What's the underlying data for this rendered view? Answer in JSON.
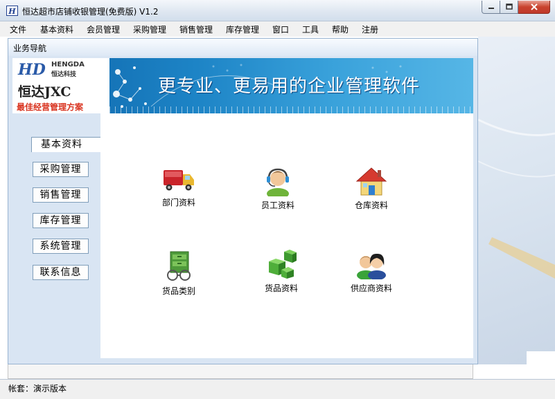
{
  "window": {
    "title": "恒达超市店铺收银管理(免费版) V1.2",
    "icon_letter": "H"
  },
  "menu": [
    {
      "label": "文件"
    },
    {
      "label": "基本资料"
    },
    {
      "label": "会员管理"
    },
    {
      "label": "采购管理"
    },
    {
      "label": "销售管理"
    },
    {
      "label": "库存管理"
    },
    {
      "label": "窗口"
    },
    {
      "label": "工具"
    },
    {
      "label": "帮助"
    },
    {
      "label": "注册"
    }
  ],
  "nav_panel": {
    "title": "业务导航"
  },
  "banner": {
    "logo_letters": "HD",
    "logo_en": "HENGDA",
    "logo_cn": "恒达科技",
    "brand": "恒达JXC",
    "slogan": "最佳经营管理方案",
    "tagline": "更专业、更易用的企业管理软件"
  },
  "sidebar": {
    "active": "基本资料",
    "items": [
      {
        "label": "基本资料"
      },
      {
        "label": "采购管理"
      },
      {
        "label": "销售管理"
      },
      {
        "label": "库存管理"
      },
      {
        "label": "系统管理"
      },
      {
        "label": "联系信息"
      }
    ]
  },
  "tiles": [
    {
      "label": "部门资料",
      "icon": "truck-icon"
    },
    {
      "label": "员工资料",
      "icon": "headset-user-icon"
    },
    {
      "label": "仓库资料",
      "icon": "house-icon"
    },
    {
      "label": "货品类别",
      "icon": "cabinet-icon"
    },
    {
      "label": "货品资料",
      "icon": "cubes-icon"
    },
    {
      "label": "供应商资料",
      "icon": "people-icon"
    }
  ],
  "status": {
    "text": "帐套：演示版本"
  },
  "colors": {
    "banner_blue": "#1d84c6",
    "slogan_red": "#d9331f",
    "panel_bg": "#d9e5f3",
    "close_red": "#c9432e"
  }
}
